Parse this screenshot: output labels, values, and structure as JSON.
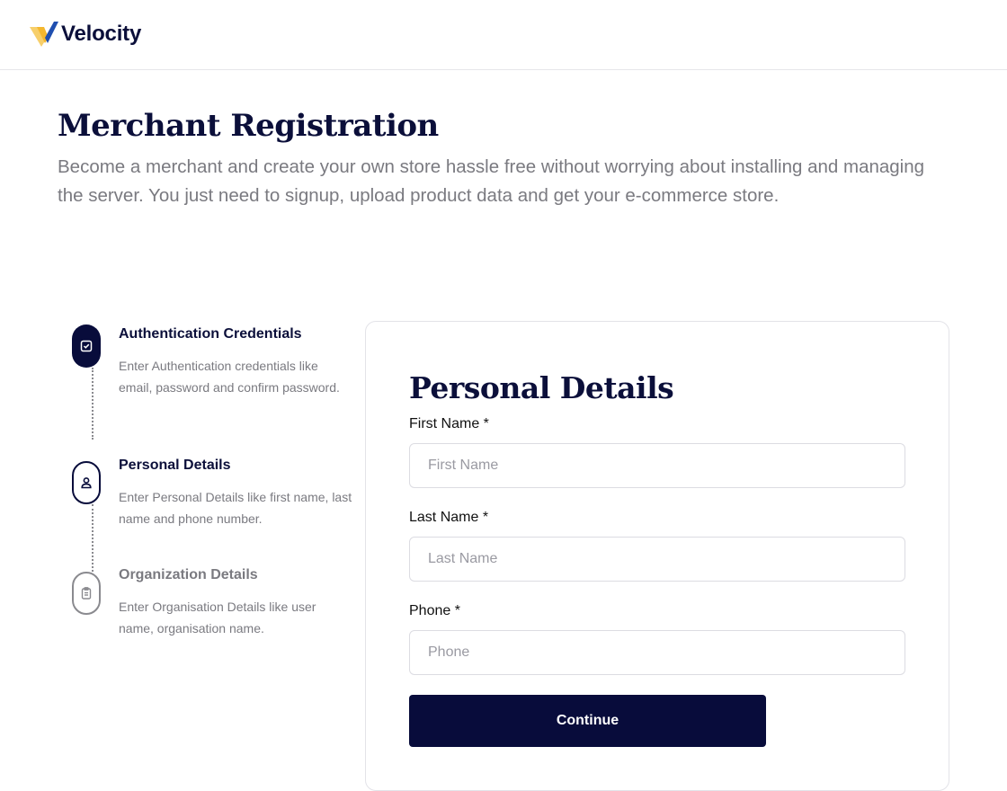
{
  "header": {
    "brand_name": "Velocity",
    "logo_icon": "velocity-logo-icon",
    "logo_colors": {
      "gold": "#f4b72e",
      "light_gold": "#f7cf6b",
      "blue": "#1f4fb0"
    }
  },
  "intro": {
    "title": "Merchant Registration",
    "description": "Become a merchant and create your own store hassle free without worrying about installing and managing the server. You just need to signup, upload product data and get your e-commerce store."
  },
  "stepper": {
    "steps": [
      {
        "title": "Authentication Credentials",
        "description": "Enter Authentication credentials like email, password and confirm password.",
        "icon": "checkbox-icon",
        "status": "completed"
      },
      {
        "title": "Personal Details",
        "description": "Enter Personal Details like first name, last name and phone number.",
        "icon": "user-icon",
        "status": "current"
      },
      {
        "title": "Organization Details",
        "description": "Enter Organisation Details like user name, organisation name.",
        "icon": "clipboard-icon",
        "status": "pending"
      }
    ]
  },
  "form": {
    "title": "Personal Details",
    "fields": [
      {
        "label": "First Name *",
        "placeholder": "First Name",
        "value": ""
      },
      {
        "label": "Last Name *",
        "placeholder": "Last Name",
        "value": ""
      },
      {
        "label": "Phone *",
        "placeholder": "Phone",
        "value": ""
      }
    ],
    "submit_label": "Continue"
  },
  "colors": {
    "primary": "#080c3b",
    "muted_text": "#7a7a80",
    "border": "#dcdce2"
  }
}
